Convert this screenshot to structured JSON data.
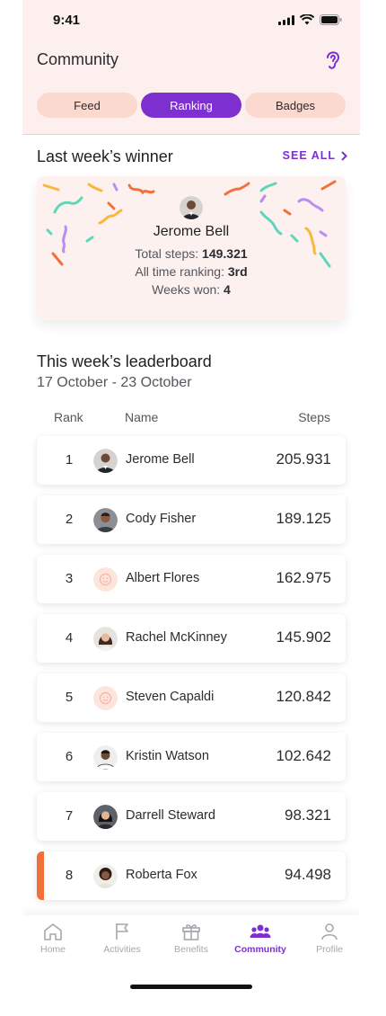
{
  "status": {
    "time": "9:41"
  },
  "header": {
    "title": "Community",
    "icon": "ear-icon"
  },
  "tabs": [
    {
      "label": "Feed",
      "active": false
    },
    {
      "label": "Ranking",
      "active": true
    },
    {
      "label": "Badges",
      "active": false
    }
  ],
  "winner_section": {
    "title": "Last week’s winner",
    "see_all": "SEE ALL",
    "name": "Jerome Bell",
    "total_steps_label": "Total steps:",
    "total_steps": "149.321",
    "ranking_label": "All time ranking:",
    "ranking": "3rd",
    "weeks_label": "Weeks won:",
    "weeks": "4"
  },
  "leaderboard": {
    "title": "This week’s leaderboard",
    "date_range": "17 October - 23 October",
    "col_rank": "Rank",
    "col_name": "Name",
    "col_steps": "Steps",
    "rows": [
      {
        "rank": "1",
        "name": "Jerome Bell",
        "steps": "205.931",
        "avatar": "photo"
      },
      {
        "rank": "2",
        "name": "Cody Fisher",
        "steps": "189.125",
        "avatar": "photo"
      },
      {
        "rank": "3",
        "name": "Albert Flores",
        "steps": "162.975",
        "avatar": "placeholder"
      },
      {
        "rank": "4",
        "name": "Rachel McKinney",
        "steps": "145.902",
        "avatar": "photo"
      },
      {
        "rank": "5",
        "name": "Steven Capaldi",
        "steps": "120.842",
        "avatar": "placeholder"
      },
      {
        "rank": "6",
        "name": "Kristin Watson",
        "steps": "102.642",
        "avatar": "photo"
      },
      {
        "rank": "7",
        "name": "Darrell Steward",
        "steps": "98.321",
        "avatar": "photo"
      },
      {
        "rank": "8",
        "name": "Roberta Fox",
        "steps": "94.498",
        "avatar": "photo",
        "highlighted": true
      }
    ]
  },
  "nav": [
    {
      "label": "Home",
      "icon": "home-icon",
      "active": false
    },
    {
      "label": "Activities",
      "icon": "flag-icon",
      "active": false
    },
    {
      "label": "Benefits",
      "icon": "gift-icon",
      "active": false
    },
    {
      "label": "Community",
      "icon": "community-icon",
      "active": true
    },
    {
      "label": "Profile",
      "icon": "profile-icon",
      "active": false
    }
  ],
  "colors": {
    "accent": "#7d2fd0",
    "header_bg": "#fdefed",
    "tab_bg": "#fbd9cf",
    "highlight": "#f2703a"
  }
}
